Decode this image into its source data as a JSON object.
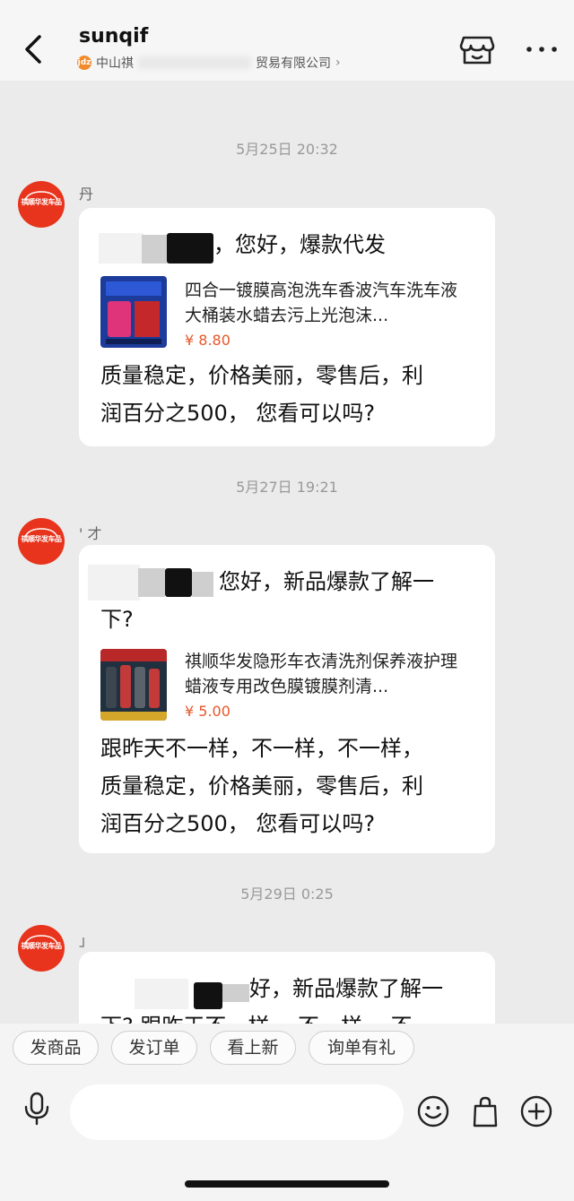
{
  "header": {
    "title": "sunqif",
    "shop_badge": "jdz",
    "subtitle_prefix": "中山祺",
    "subtitle_suffix": "贸易有限公司",
    "subtitle_chevron": "›"
  },
  "messages": [
    {
      "timestamp": "5月25日 20:32",
      "sender": "丹",
      "avatar_text": "祺顺华发车品",
      "greeting": "，您好，爆款代发",
      "product": {
        "title": "四合一镀膜高泡洗车香波汽车洗车液大桶装水蜡去污上光泡沫...",
        "price": "¥ 8.80"
      },
      "body_lines": [
        "质量稳定，价格美丽，零售后，利",
        "润百分之500，  您看可以吗?"
      ]
    },
    {
      "timestamp": "5月27日 19:21",
      "sender": "' 才",
      "avatar_text": "祺顺华发车品",
      "greeting_lines": [
        "您好，新品爆款了解一",
        "下?"
      ],
      "product": {
        "title": "祺顺华发隐形车衣清洗剂保养液护理蜡液专用改色膜镀膜剂清...",
        "price": "¥ 5.00"
      },
      "body_lines": [
        "跟昨天不一样，不一样，不一样，",
        "质量稳定，价格美丽，零售后，利",
        "润百分之500，  您看可以吗?"
      ]
    },
    {
      "timestamp": "5月29日 0:25",
      "sender": "」",
      "avatar_text": "祺顺华发车品",
      "greeting_lines": [
        "好，新品爆款了解一",
        "下?  跟昨天不一样，  不一样，  不一"
      ]
    }
  ],
  "quick_actions": [
    "发商品",
    "发订单",
    "看上新",
    "询单有礼"
  ],
  "input": {
    "placeholder": ""
  },
  "colors": {
    "accent": "#e8341c",
    "price": "#e8572a",
    "background": "#ebebeb"
  }
}
